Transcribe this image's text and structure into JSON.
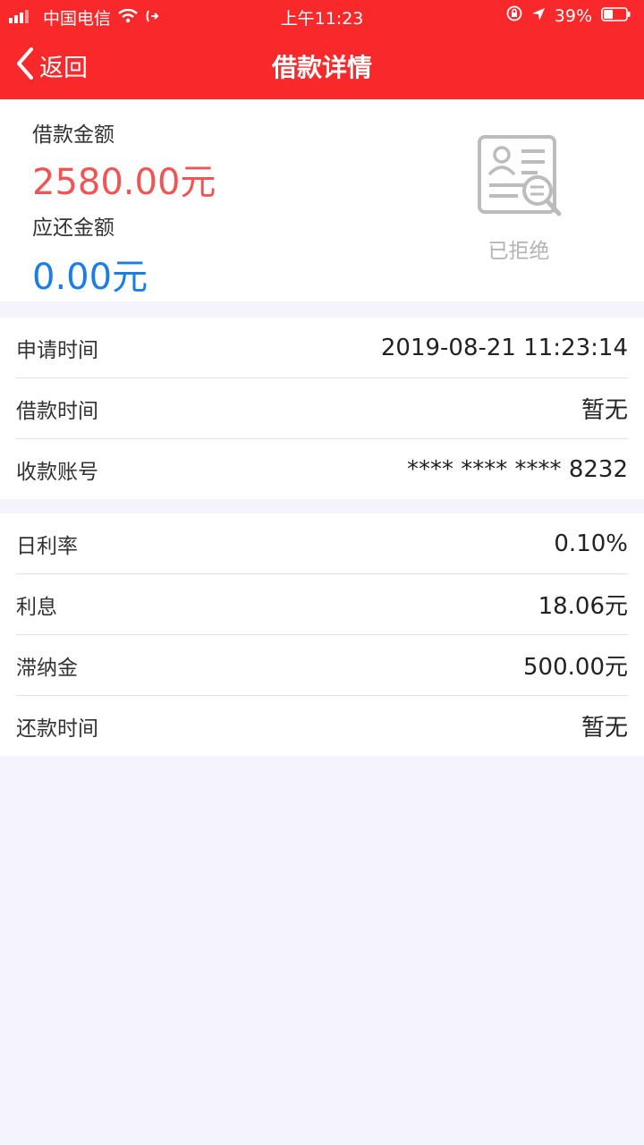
{
  "status_bar": {
    "carrier": "中国电信",
    "time": "上午11:23",
    "battery": "39%"
  },
  "nav": {
    "back_label": "返回",
    "title": "借款详情"
  },
  "summary": {
    "loan_amount_label": "借款金额",
    "loan_amount_value": "2580.00元",
    "repay_amount_label": "应还金额",
    "repay_amount_value": "0.00元",
    "status": "已拒绝"
  },
  "details": [
    {
      "label": "申请时间",
      "value": "2019-08-21 11:23:14"
    },
    {
      "label": "借款时间",
      "value": "暂无"
    },
    {
      "label": "收款账号",
      "value": "**** **** **** 8232"
    }
  ],
  "fees": [
    {
      "label": "日利率",
      "value": "0.10%"
    },
    {
      "label": "利息",
      "value": "18.06元"
    },
    {
      "label": "滞纳金",
      "value": "500.00元"
    },
    {
      "label": "还款时间",
      "value": "暂无"
    }
  ],
  "colors": {
    "header": "#f9292b",
    "loan_amount": "#f05554",
    "repay_amount": "#1a7ee6",
    "status": "#b3b3b3"
  }
}
